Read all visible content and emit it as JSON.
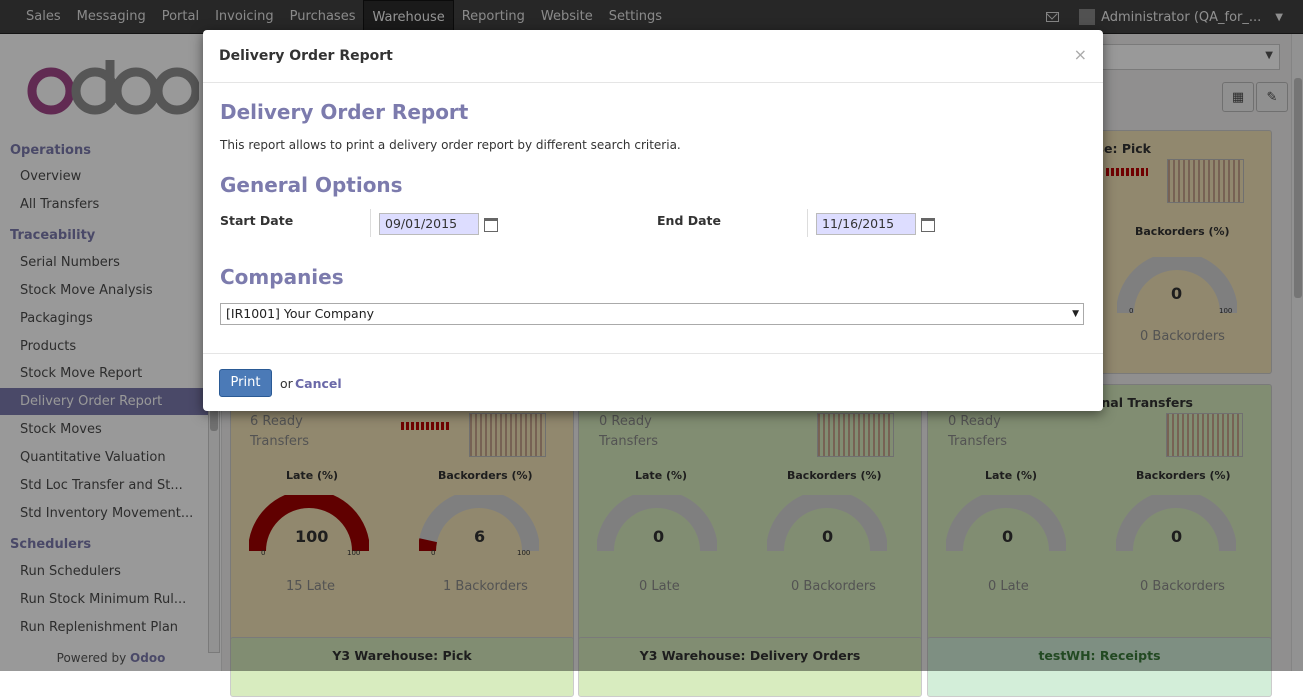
{
  "topbar": {
    "menu": [
      "Sales",
      "Messaging",
      "Portal",
      "Invoicing",
      "Purchases",
      "Warehouse",
      "Reporting",
      "Website",
      "Settings"
    ],
    "active": "Warehouse",
    "user": "Administrator (QA_for_..."
  },
  "sidebar": {
    "sections": {
      "operations": "Operations",
      "traceability": "Traceability",
      "schedulers": "Schedulers"
    },
    "operations_items": [
      "Overview",
      "All Transfers"
    ],
    "traceability_items": [
      "Serial Numbers",
      "Stock Move Analysis",
      "Packagings",
      "Products",
      "Stock Move Report",
      "Delivery Order Report",
      "Stock Moves",
      "Quantitative Valuation",
      "Std Loc Transfer and St...",
      "Std Inventory Movement..."
    ],
    "schedulers_items": [
      "Run Schedulers",
      "Run Stock Minimum Rul...",
      "Run Replenishment Plan"
    ],
    "active_item": "Delivery Order Report",
    "powered_prefix": "Powered by",
    "powered_brand": "Odoo"
  },
  "dashboard": {
    "cards_row1": [
      {
        "title": "use: Pick",
        "backorders_label": "Backorders (%)",
        "backorders_value": "0",
        "min": "0",
        "max": "100",
        "footer": "0 Backorders"
      }
    ],
    "cards_row2": [
      {
        "ready": "6 Ready",
        "transfers": "Transfers",
        "late_label": "Late (%)",
        "late_value": "100",
        "late_footer": "15 Late",
        "back_label": "Backorders (%)",
        "back_value": "6",
        "back_footer": "1 Backorders"
      },
      {
        "ready": "0 Ready",
        "transfers": "Transfers",
        "late_label": "Late (%)",
        "late_value": "0",
        "late_footer": "0 Late",
        "back_label": "Backorders (%)",
        "back_value": "0",
        "back_footer": "0 Backorders"
      },
      {
        "title": "ernal Transfers",
        "ready": "0 Ready",
        "transfers": "Transfers",
        "late_label": "Late (%)",
        "late_value": "0",
        "late_footer": "0 Late",
        "back_label": "Backorders (%)",
        "back_value": "0",
        "back_footer": "0 Backorders"
      }
    ],
    "cards_row3": [
      "Y3 Warehouse: Pick",
      "Y3 Warehouse: Delivery Orders",
      "testWH: Receipts"
    ],
    "gauge_min": "0",
    "gauge_max": "100"
  },
  "modal": {
    "title": "Delivery Order Report",
    "heading": "Delivery Order Report",
    "description": "This report allows to print a delivery order report by different search criteria.",
    "general_options": "General Options",
    "start_date_label": "Start Date",
    "start_date": "09/01/2015",
    "end_date_label": "End Date",
    "end_date": "11/16/2015",
    "companies_heading": "Companies",
    "company_selected": "[IR1001] Your Company",
    "print_label": "Print",
    "or_label": "or",
    "cancel_label": "Cancel",
    "close": "×"
  },
  "colors": {
    "accent": "#7c7bad",
    "late_red": "#a00000",
    "print_blue": "#4b7ab7"
  }
}
